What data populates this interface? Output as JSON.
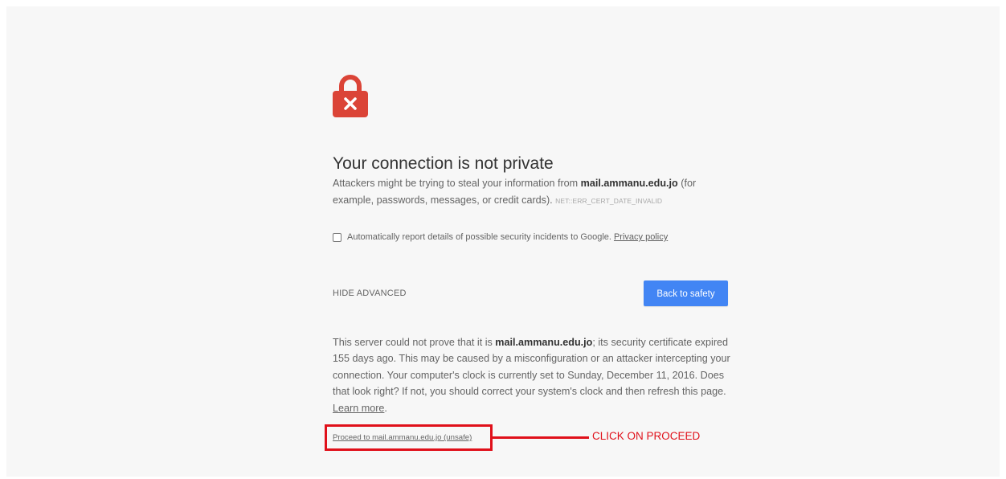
{
  "colors": {
    "page_background": "#f7f7f7",
    "lock_red": "#db4437",
    "button_blue": "#4285f4",
    "annotation_red": "#e0101a"
  },
  "icons": {
    "lock": "lock-error-icon"
  },
  "title": "Your connection is not private",
  "message": {
    "prefix": "Attackers might be trying to steal your information from ",
    "host": "mail.ammanu.edu.jo",
    "suffix": " (for example, passwords, messages, or credit cards). ",
    "error_code": "NET::ERR_CERT_DATE_INVALID"
  },
  "report_checkbox": {
    "checked": false,
    "label": "Automatically report details of possible security incidents to Google.",
    "link": "Privacy policy"
  },
  "hide_advanced": "HIDE ADVANCED",
  "back_button": "Back to safety",
  "details": {
    "prefix": "This server could not prove that it is ",
    "host": "mail.ammanu.edu.jo",
    "suffix": "; its security certificate expired 155 days ago. This may be caused by a misconfiguration or an attacker intercepting your connection. Your computer's clock is currently set to Sunday, December 11, 2016. Does that look right? If not, you should correct your system's clock and then refresh this page. ",
    "learn_more": "Learn more",
    "period": "."
  },
  "proceed_link": "Proceed to mail.ammanu.edu.jo (unsafe)",
  "annotation": "CLICK ON PROCEED"
}
